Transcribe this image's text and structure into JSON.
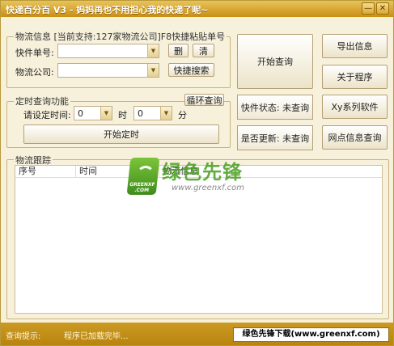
{
  "window": {
    "title": "快递百分百 V3 - 妈妈再也不用担心我的快递了呢~",
    "minimize_glyph": "—",
    "close_glyph": "✕"
  },
  "tracking_group": {
    "legend": "物流信息 [当前支持:127家物流公司]F8快捷粘贴单号",
    "tracking_number_label": "快件单号:",
    "tracking_number_value": "",
    "company_label": "物流公司:",
    "company_value": "",
    "delete_button": "删",
    "clear_button": "清",
    "quick_search_button": "快捷搜索"
  },
  "timer_group": {
    "legend": "定时查询功能",
    "loop_query_button": "循环查询",
    "set_time_label": "请设定时间:",
    "hour_value": "0",
    "hour_unit": "时",
    "minute_value": "0",
    "minute_unit": "分",
    "start_timer_button": "开始定时"
  },
  "actions": {
    "start_query_button": "开始查询",
    "export_button": "导出信息",
    "about_button": "关于程序",
    "xy_series_button": "Xy系列软件",
    "outlet_query_button": "网点信息查询"
  },
  "status": {
    "package_status": "快件状态: 未查询",
    "update_status": "是否更新: 未查询"
  },
  "trace_group": {
    "legend": "物流跟踪",
    "columns": [
      "序号",
      "时间",
      "物流信息"
    ]
  },
  "statusbar": {
    "label": "查询提示:",
    "message": "程序已加载完毕...",
    "promo": "绿色先锋下载(www.greenxf.com)"
  },
  "watermark": {
    "logo_text": "GREENXF .COM",
    "brand": "绿色先锋",
    "url": "www.greenxf.com"
  },
  "colors": {
    "titlebar": "#c98f14",
    "window_bg": "#f7f1dc",
    "watermark_green": "#4a9e22"
  },
  "icons": {
    "dropdown": "chevron-down-icon",
    "logo": "greenxf-logo-icon"
  }
}
